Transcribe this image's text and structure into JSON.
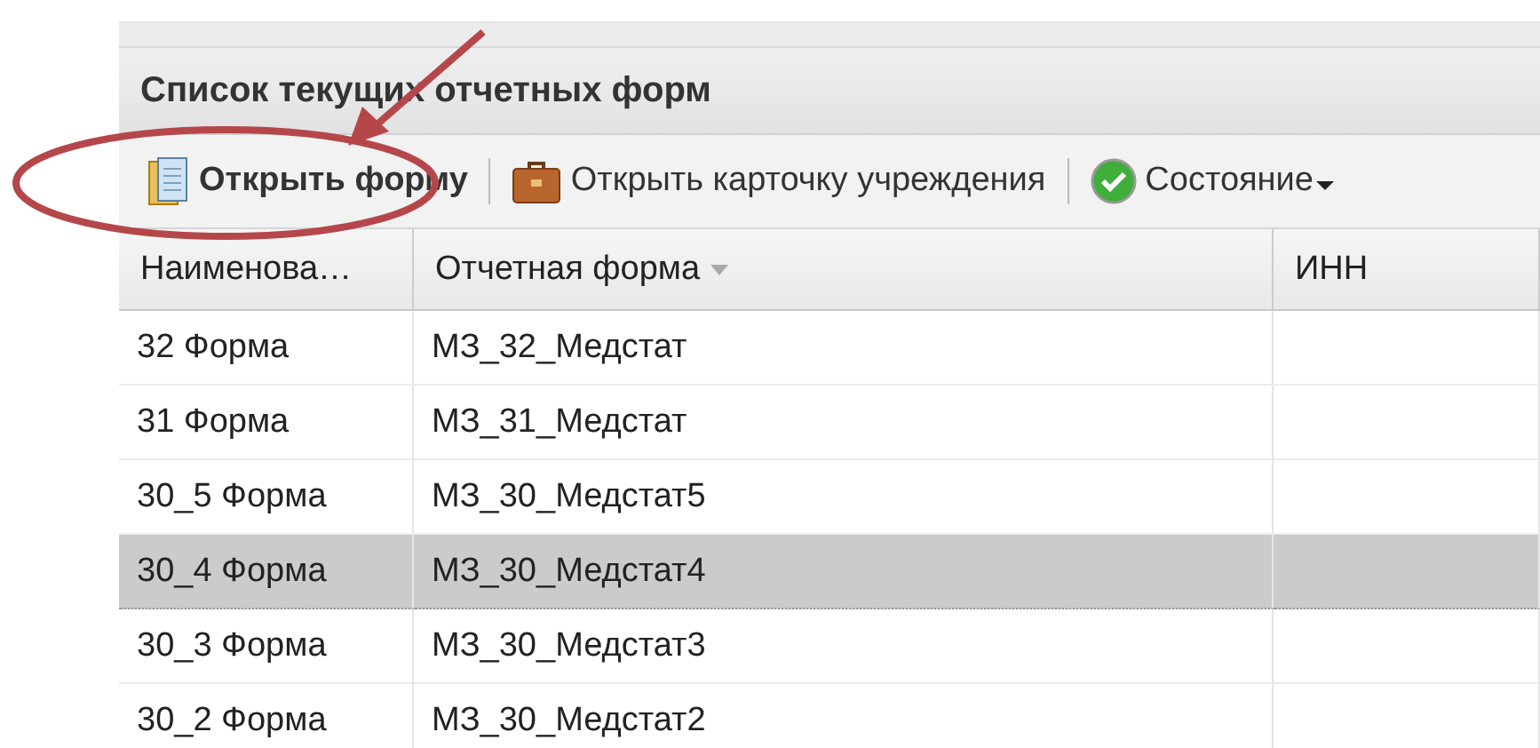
{
  "panel": {
    "title": "Список текущих отчетных форм"
  },
  "toolbar": [
    {
      "label": "Открыть форму",
      "emphasized": true,
      "dropdown": false
    },
    {
      "label": "Открыть карточку учреждения",
      "emphasized": false,
      "dropdown": false
    },
    {
      "label": "Состояние",
      "emphasized": false,
      "dropdown": true
    }
  ],
  "table": {
    "columns": [
      {
        "label": "Наименова…",
        "sorted": false
      },
      {
        "label": "Отчетная форма",
        "sorted": true
      },
      {
        "label": "ИНН",
        "sorted": false
      }
    ],
    "rows": [
      {
        "cells": [
          "32 Форма",
          "МЗ_32_Медстат",
          ""
        ],
        "selected": false
      },
      {
        "cells": [
          "31 Форма",
          "МЗ_31_Медстат",
          ""
        ],
        "selected": false
      },
      {
        "cells": [
          "30_5 Форма",
          "МЗ_30_Медстат5",
          ""
        ],
        "selected": false
      },
      {
        "cells": [
          "30_4 Форма",
          "МЗ_30_Медстат4",
          ""
        ],
        "selected": true
      },
      {
        "cells": [
          "30_3 Форма",
          "МЗ_30_Медстат3",
          ""
        ],
        "selected": false
      },
      {
        "cells": [
          "30_2 Форма",
          "МЗ_30_Медстат2",
          ""
        ],
        "selected": false
      }
    ]
  }
}
